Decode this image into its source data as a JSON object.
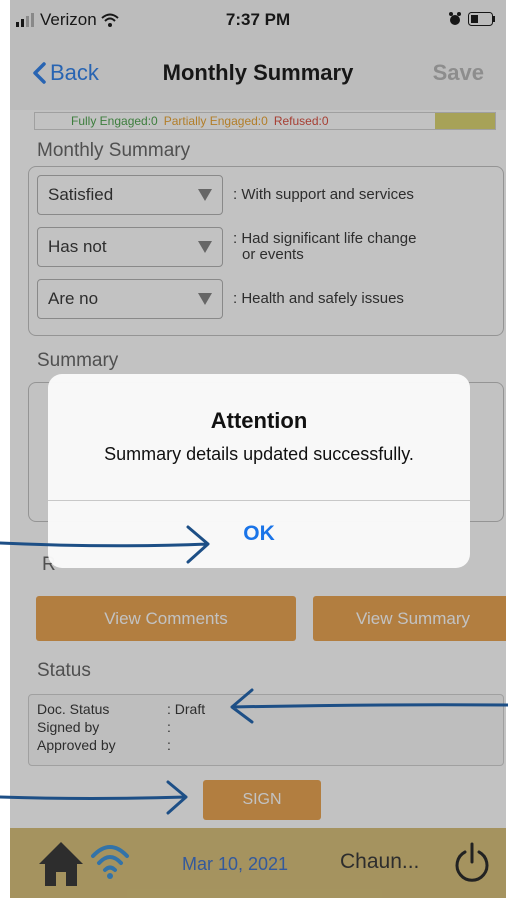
{
  "statusbar": {
    "carrier": "Verizon",
    "time": "7:37 PM"
  },
  "nav": {
    "back_label": "Back",
    "title": "Monthly Summary",
    "save_label": "Save"
  },
  "legend": {
    "fully": "Fully Engaged:0",
    "partially": "Partially Engaged:0",
    "refused": "Refused:0"
  },
  "monthly": {
    "title": "Monthly Summary",
    "rows": [
      {
        "value": "Satisfied",
        "desc": ": With support and services"
      },
      {
        "value": "Has not",
        "desc": ": Had significant life change",
        "desc2": "or events"
      },
      {
        "value": "Are no",
        "desc": ": Health and safely issues"
      }
    ]
  },
  "summary": {
    "title": "Summary"
  },
  "partial_label": "R",
  "buttons": {
    "view_comments": "View Comments",
    "view_summary": "View Summary",
    "sign": "SIGN"
  },
  "status": {
    "title": "Status",
    "doc_status_label": "Doc. Status",
    "doc_status_value": ": Draft",
    "signed_by_label": "Signed by",
    "signed_by_value": ":",
    "approved_by_label": "Approved by",
    "approved_by_value": ":"
  },
  "bottombar": {
    "date": "Mar 10, 2021",
    "user": "Chaun..."
  },
  "alert": {
    "title": "Attention",
    "message": "Summary details updated successfully.",
    "ok": "OK"
  },
  "colors": {
    "accent": "#1a74e8",
    "button_orange": "#e89a3e",
    "bottom_bar": "#d4ba6c",
    "annotation": "#1d4f86"
  }
}
